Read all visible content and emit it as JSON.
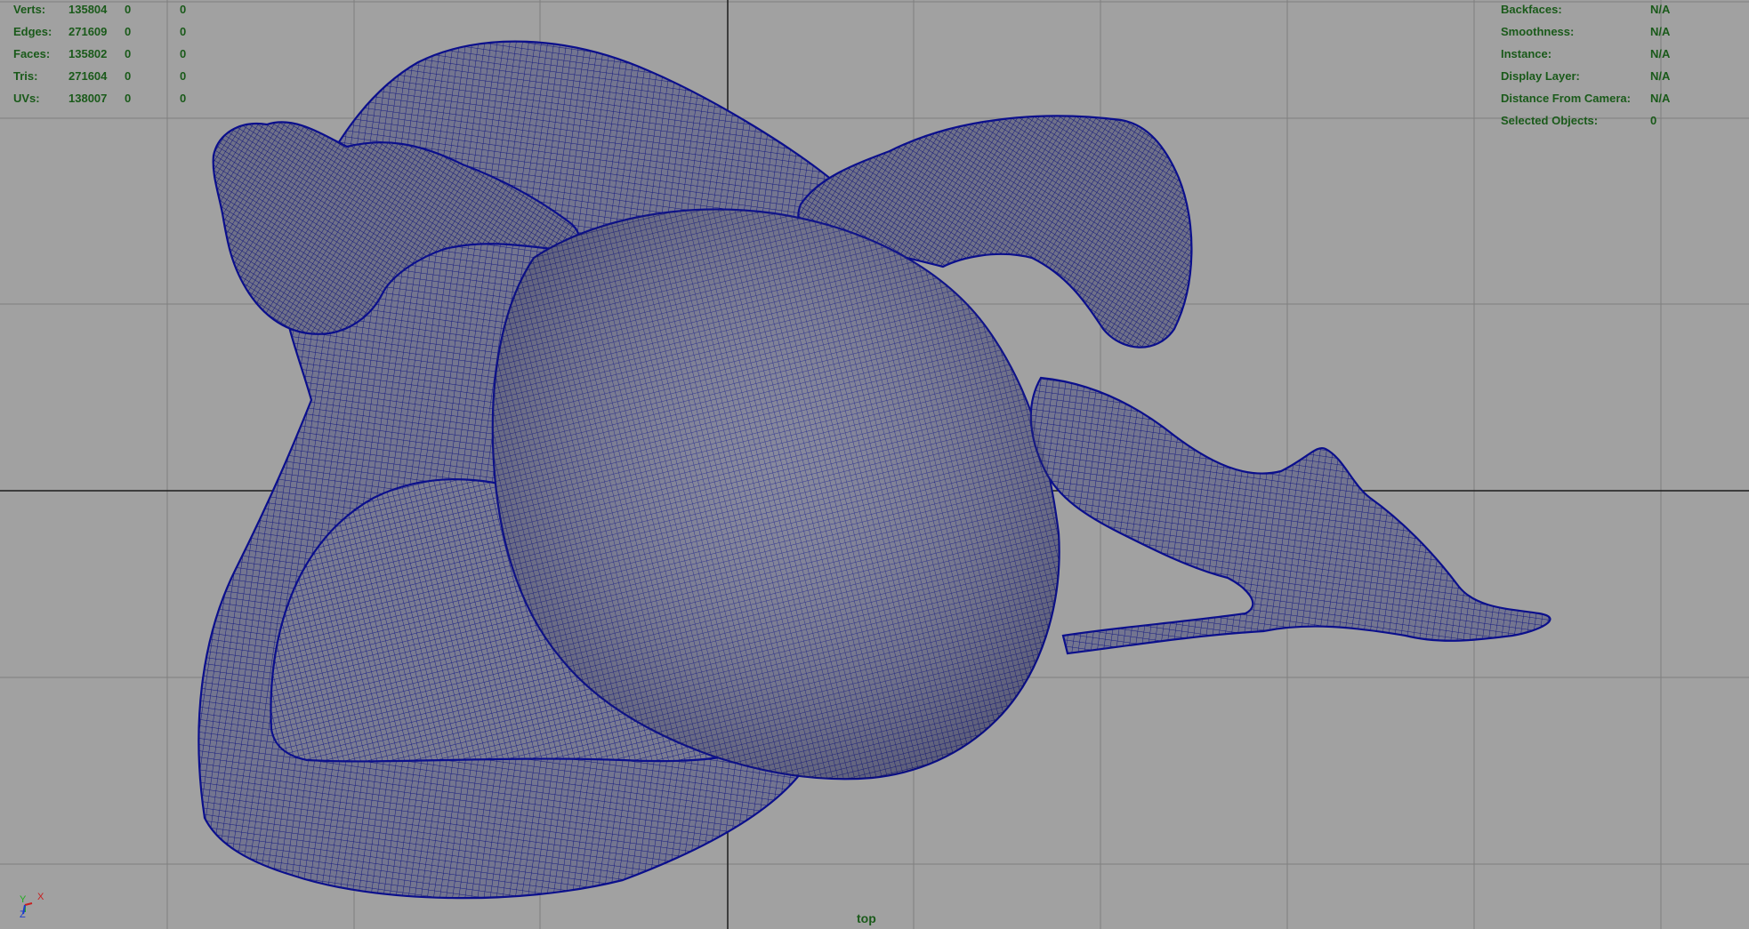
{
  "viewport": {
    "camera_name": "top"
  },
  "heads_up_display": {
    "poly_count": [
      {
        "label": "Verts:",
        "object": "135804",
        "selection": "0",
        "component": "0"
      },
      {
        "label": "Edges:",
        "object": "271609",
        "selection": "0",
        "component": "0"
      },
      {
        "label": "Faces:",
        "object": "135802",
        "selection": "0",
        "component": "0"
      },
      {
        "label": "Tris:",
        "object": "271604",
        "selection": "0",
        "component": "0"
      },
      {
        "label": "UVs:",
        "object": "138007",
        "selection": "0",
        "component": "0"
      }
    ],
    "object_details": [
      {
        "label": "Backfaces:",
        "value": "N/A"
      },
      {
        "label": "Smoothness:",
        "value": "N/A"
      },
      {
        "label": "Instance:",
        "value": "N/A"
      },
      {
        "label": "Display Layer:",
        "value": "N/A"
      },
      {
        "label": "Distance From Camera:",
        "value": "N/A"
      },
      {
        "label": "Selected Objects:",
        "value": "0"
      }
    ]
  },
  "axis_gizmo": {
    "axes": [
      "Y",
      "X",
      "Z"
    ]
  },
  "colors": {
    "background": "#a1a1a1",
    "grid_line": "#7f7f7f",
    "grid_axis": "#222222",
    "hud_text": "#1a5a1a",
    "wireframe": "#0a0a7a",
    "mesh_shade": "#6e7088"
  }
}
